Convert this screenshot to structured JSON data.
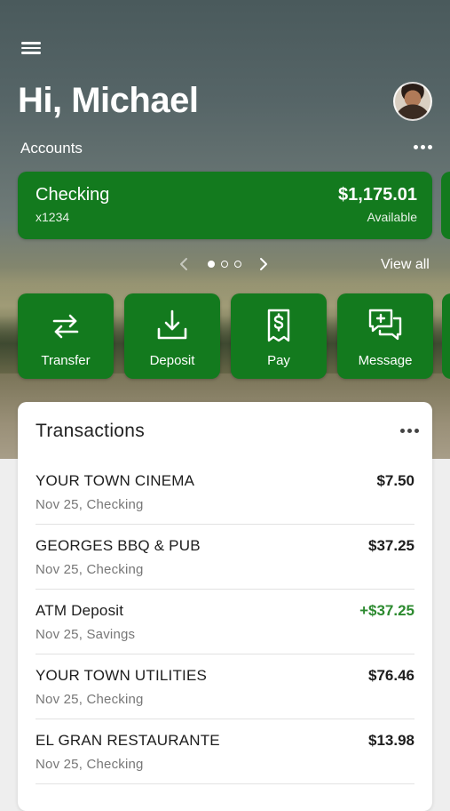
{
  "header": {
    "greeting": "Hi, Michael"
  },
  "accounts": {
    "label": "Accounts",
    "view_all": "View all",
    "pager": {
      "total": 3,
      "current": 1
    },
    "card": {
      "name": "Checking",
      "number": "x1234",
      "balance": "$1,175.01",
      "balance_label": "Available"
    }
  },
  "actions": [
    {
      "label": "Transfer",
      "icon": "transfer-icon"
    },
    {
      "label": "Deposit",
      "icon": "deposit-icon"
    },
    {
      "label": "Pay",
      "icon": "pay-icon"
    },
    {
      "label": "Message",
      "icon": "message-icon"
    }
  ],
  "transactions": {
    "title": "Transactions",
    "items": [
      {
        "name": "YOUR TOWN CINEMA",
        "meta": "Nov 25, Checking",
        "amount": "$7.50",
        "type": "debit"
      },
      {
        "name": "GEORGES BBQ & PUB",
        "meta": "Nov 25, Checking",
        "amount": "$37.25",
        "type": "debit"
      },
      {
        "name": "ATM Deposit",
        "meta": "Nov 25, Savings",
        "amount": "+$37.25",
        "type": "credit"
      },
      {
        "name": "YOUR TOWN UTILITIES",
        "meta": "Nov 25, Checking",
        "amount": "$76.46",
        "type": "debit"
      },
      {
        "name": "EL GRAN RESTAURANTE",
        "meta": "Nov 25, Checking",
        "amount": "$13.98",
        "type": "debit"
      }
    ]
  },
  "colors": {
    "brand_green": "#137a1e",
    "credit_green": "#2c8a2f"
  }
}
